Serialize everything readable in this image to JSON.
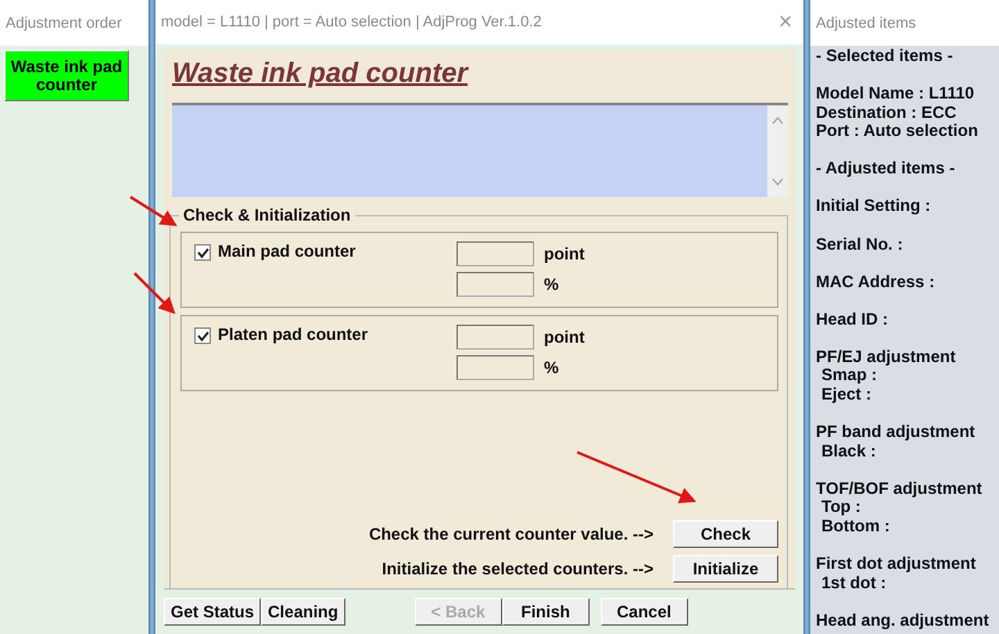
{
  "left_panel": {
    "title": "Adjustment order",
    "items": [
      {
        "label": "Waste ink pad counter",
        "selected": true
      }
    ]
  },
  "window": {
    "title": "model = L1110 | port = Auto selection | AdjProg Ver.1.0.2",
    "close": "×"
  },
  "heading": "Waste ink pad counter",
  "group": {
    "title": "Check & Initialization",
    "counters": [
      {
        "label": "Main pad counter",
        "checked": true,
        "units": [
          "point",
          "%"
        ]
      },
      {
        "label": "Platen pad counter",
        "checked": true,
        "units": [
          "point",
          "%"
        ]
      }
    ]
  },
  "actions": [
    {
      "text": "Check the current counter value. -->",
      "button": "Check"
    },
    {
      "text": "Initialize the selected counters. -->",
      "button": "Initialize"
    }
  ],
  "tool_buttons": [
    {
      "label": "Get Status",
      "disabled": false
    },
    {
      "label": "Cleaning",
      "disabled": false
    }
  ],
  "nav_buttons": [
    {
      "label": "< Back",
      "disabled": true
    },
    {
      "label": "Finish",
      "disabled": false
    },
    {
      "label": "Cancel",
      "disabled": false
    }
  ],
  "right_panel": {
    "title": "Adjusted items",
    "sections": [
      [
        {
          "text": "- Selected items -",
          "indented": false
        }
      ],
      [
        {
          "text": "Model Name : L1110",
          "indented": false
        },
        {
          "text": "Destination : ECC",
          "indented": false
        },
        {
          "text": "Port : Auto selection",
          "indented": false
        }
      ],
      [
        {
          "text": "- Adjusted items -",
          "indented": false
        }
      ],
      [
        {
          "text": "Initial Setting :",
          "indented": false
        }
      ],
      [
        {
          "text": "Serial No. :",
          "indented": false
        }
      ],
      [
        {
          "text": "MAC Address :",
          "indented": false
        }
      ],
      [
        {
          "text": "Head ID :",
          "indented": false
        }
      ],
      [
        {
          "text": "PF/EJ adjustment",
          "indented": false
        },
        {
          "text": "Smap :",
          "indented": true
        },
        {
          "text": "Eject :",
          "indented": true
        }
      ],
      [
        {
          "text": "PF band adjustment",
          "indented": false
        },
        {
          "text": "Black :",
          "indented": true
        }
      ],
      [
        {
          "text": "TOF/BOF adjustment",
          "indented": false
        },
        {
          "text": "Top :",
          "indented": true
        },
        {
          "text": "Bottom :",
          "indented": true
        }
      ],
      [
        {
          "text": "First dot adjustment",
          "indented": false
        },
        {
          "text": "1st dot :",
          "indented": true
        }
      ],
      [
        {
          "text": "Head ang. adjustment",
          "indented": false
        }
      ]
    ]
  }
}
